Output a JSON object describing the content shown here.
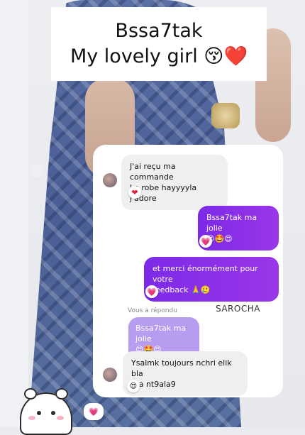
{
  "caption": {
    "line1": "Bssa7tak",
    "line2": "My lovely girl 😚❤️"
  },
  "chat": {
    "messages": [
      {
        "text": "J'ai reçu ma commande\nLa robe hayyyyla j'adore",
        "reaction": "❤"
      },
      {
        "text": "Bssa7tak ma jolie\n😍🤩😍",
        "reaction": "💗"
      },
      {
        "text": "et merci énormément pour votre\nfeedback 🙏🥲",
        "reaction": "💗"
      },
      {
        "text": "Ysalmk toujours nchri elik bla\nma nt9ala9",
        "reaction": "😍"
      }
    ],
    "reply_meta": "Vous a répondu",
    "sender_name": "SAROCHA",
    "quoted_text": "Bssa7tak ma jolie\n😍🤩😍"
  },
  "colors": {
    "outgoing_bubble": "#8a2be2",
    "quoted_bubble": "#b89cf0",
    "incoming_bubble": "#efefef"
  },
  "stickers": {
    "bear": "bear-sticker",
    "heart_bubble": "💗"
  }
}
